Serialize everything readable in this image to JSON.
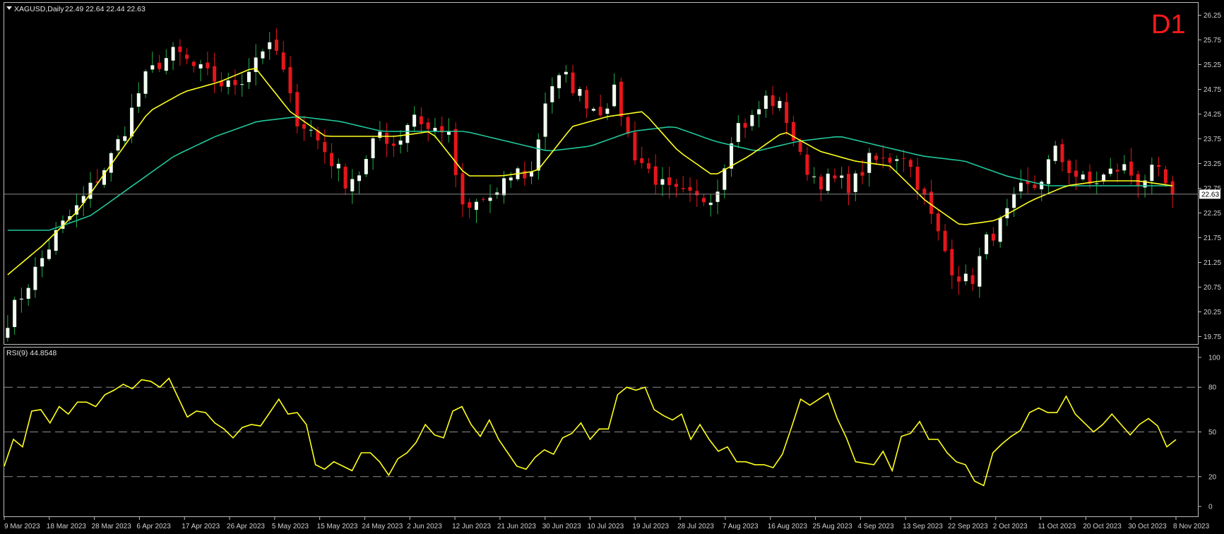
{
  "header": {
    "symbol": "XAGUSD,Daily",
    "ohlc": "22.49 22.64 22.44 22.63",
    "timeframe_badge": "D1",
    "current_price_label": "22.63"
  },
  "colors": {
    "background": "#000000",
    "bull_candle": "#f2fff2",
    "bear_candle": "#e5161b",
    "ma_fast": "#ffff1e",
    "ma_slow": "#21c79a",
    "rsi_line": "#ffff1e",
    "badge": "#ff1a1a"
  },
  "rsi_panel": {
    "label": "RSI(9) 44.8548",
    "levels": [
      80,
      50,
      20
    ],
    "scale_labels": [
      "100",
      "80",
      "50",
      "20",
      "0"
    ]
  },
  "chart_data": [
    {
      "type": "candlestick",
      "title": "XAGUSD,Daily",
      "ylim": [
        19.6,
        26.5
      ],
      "y_ticks": [
        "26.25",
        "25.75",
        "25.25",
        "24.75",
        "24.25",
        "23.75",
        "23.25",
        "22.75",
        "22.25",
        "21.75",
        "21.25",
        "20.75",
        "20.25",
        "19.75"
      ],
      "x_ticks": [
        "9 Mar 2023",
        "18 Mar 2023",
        "28 Mar 2023",
        "6 Apr 2023",
        "17 Apr 2023",
        "26 Apr 2023",
        "5 May 2023",
        "15 May 2023",
        "24 May 2023",
        "2 Jun 2023",
        "12 Jun 2023",
        "21 Jun 2023",
        "30 Jun 2023",
        "10 Jul 2023",
        "19 Jul 2023",
        "28 Jul 2023",
        "7 Aug 2023",
        "16 Aug 2023",
        "25 Aug 2023",
        "4 Sep 2023",
        "13 Sep 2023",
        "22 Sep 2023",
        "2 Oct 2023",
        "11 Oct 2023",
        "20 Oct 2023",
        "30 Oct 2023",
        "8 Nov 2023"
      ],
      "close_anchors": [
        20.1,
        20.7,
        21.3,
        21.9,
        22.3,
        22.8,
        23.3,
        24.0,
        24.9,
        25.3,
        25.5,
        25.2,
        25.0,
        24.8,
        25.0,
        25.6,
        25.5,
        24.2,
        23.9,
        23.4,
        22.9,
        23.1,
        23.9,
        23.6,
        24.3,
        23.9,
        24.0,
        22.2,
        22.5,
        22.6,
        23.1,
        23.0,
        24.8,
        25.0,
        24.6,
        24.3,
        24.7,
        23.5,
        23.1,
        22.7,
        22.6,
        22.5,
        22.7,
        24.0,
        24.1,
        24.6,
        24.3,
        23.3,
        22.9,
        22.9,
        22.8,
        23.3,
        23.3,
        23.5,
        22.8,
        21.9,
        21.1,
        20.8,
        21.7,
        22.1,
        22.7,
        22.8,
        23.5,
        23.1,
        22.8,
        23.0,
        23.2,
        22.9,
        23.1,
        22.6
      ],
      "ma_fast_anchors": [
        21.0,
        21.6,
        22.3,
        23.3,
        24.3,
        24.7,
        24.9,
        25.2,
        24.3,
        23.8,
        23.8,
        23.8,
        23.9,
        23.0,
        23.0,
        23.1,
        24.0,
        24.2,
        24.3,
        23.5,
        23.0,
        23.4,
        23.9,
        23.5,
        23.3,
        23.2,
        22.5,
        22.0,
        22.1,
        22.5,
        22.8,
        22.9,
        22.9,
        22.8
      ],
      "ma_slow_anchors": [
        21.9,
        21.9,
        22.2,
        22.8,
        23.4,
        23.8,
        24.1,
        24.2,
        24.1,
        23.9,
        23.9,
        23.9,
        23.7,
        23.5,
        23.6,
        23.9,
        24.0,
        23.7,
        23.5,
        23.7,
        23.8,
        23.6,
        23.4,
        23.3,
        23.0,
        22.8,
        22.8,
        22.8,
        22.8
      ],
      "current_price": 22.63,
      "grid": false
    },
    {
      "type": "line",
      "title": "RSI(9) 44.8548",
      "ylim": [
        0,
        100
      ],
      "y_ticks": [
        "100",
        "80",
        "50",
        "20",
        "0"
      ],
      "levels": [
        80,
        50,
        20
      ],
      "x_ticks": [
        "9 Mar 2023",
        "18 Mar 2023",
        "28 Mar 2023",
        "6 Apr 2023",
        "17 Apr 2023",
        "26 Apr 2023",
        "5 May 2023",
        "15 May 2023",
        "24 May 2023",
        "2 Jun 2023",
        "12 Jun 2023",
        "21 Jun 2023",
        "30 Jun 2023",
        "10 Jul 2023",
        "19 Jul 2023",
        "28 Jul 2023",
        "7 Aug 2023",
        "16 Aug 2023",
        "25 Aug 2023",
        "4 Sep 2023",
        "13 Sep 2023",
        "22 Sep 2023",
        "2 Oct 2023",
        "11 Oct 2023",
        "20 Oct 2023",
        "30 Oct 2023",
        "8 Nov 2023"
      ],
      "values": [
        27,
        45,
        40,
        64,
        65,
        56,
        67,
        62,
        70,
        70,
        67,
        75,
        78,
        82,
        79,
        85,
        84,
        80,
        86,
        73,
        60,
        64,
        63,
        56,
        52,
        46,
        53,
        55,
        54,
        63,
        72,
        62,
        63,
        55,
        28,
        25,
        30,
        27,
        24,
        36,
        36,
        30,
        21,
        32,
        36,
        43,
        55,
        48,
        46,
        64,
        67,
        55,
        47,
        58,
        45,
        36,
        27,
        25,
        33,
        38,
        35,
        46,
        49,
        56,
        45,
        52,
        52,
        75,
        80,
        78,
        80,
        65,
        61,
        58,
        62,
        45,
        55,
        45,
        37,
        40,
        30,
        30,
        28,
        28,
        26,
        35,
        53,
        72,
        68,
        72,
        76,
        59,
        46,
        30,
        29,
        28,
        37,
        24,
        47,
        49,
        57,
        45,
        45,
        36,
        30,
        28,
        17,
        14,
        36,
        42,
        47,
        51,
        63,
        66,
        63,
        63,
        74,
        62,
        56,
        50,
        55,
        62,
        55,
        48,
        55,
        59,
        54,
        40,
        44.85
      ],
      "grid": false
    }
  ]
}
